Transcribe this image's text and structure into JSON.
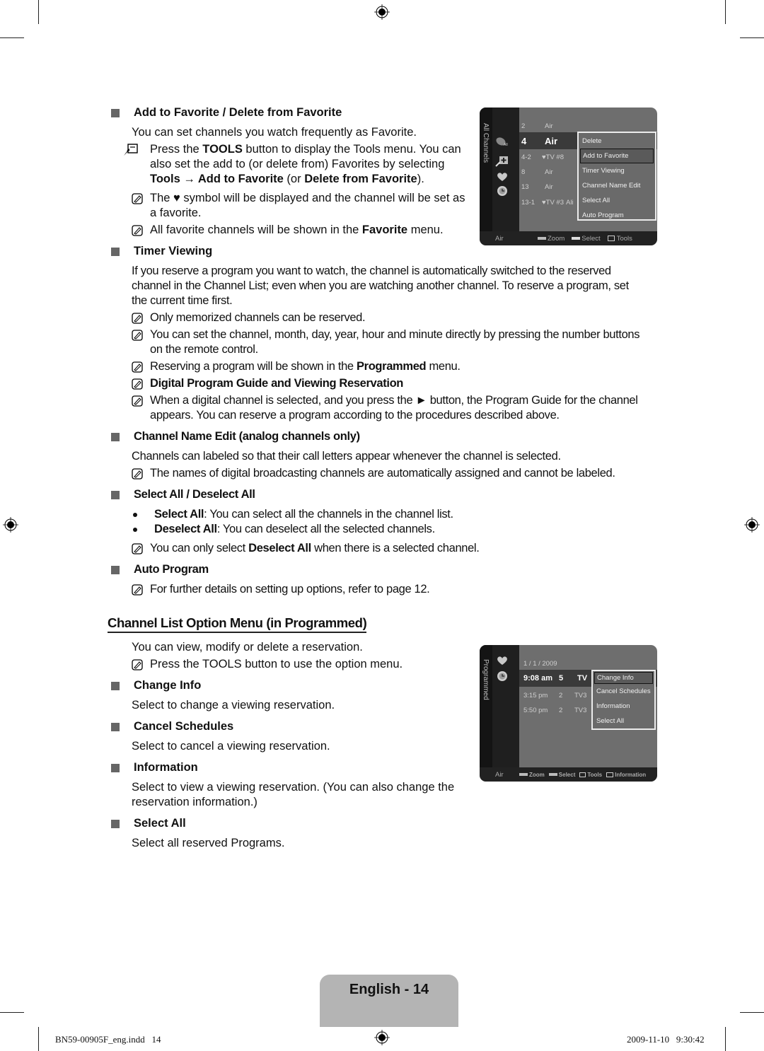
{
  "sections_top": {
    "add_fav": {
      "heading": "Add to Favorite / Delete from Favorite",
      "intro": "You can set channels you watch frequently as Favorite.",
      "tools_note": {
        "p1": "Press the ",
        "b1": "TOOLS",
        "p2": " button to display the Tools menu. You can also set the add to (or delete from) Favorites by selecting ",
        "b2": "Tools → Add to Favorite",
        "p3": " (or ",
        "b3": "Delete from Favorite",
        "p4": ")."
      },
      "note1": "The ♥ symbol will be displayed and the channel will be set as a favorite.",
      "note2": {
        "p1": "All favorite channels will be shown in the ",
        "b1": "Favorite",
        "p2": " menu."
      }
    },
    "timer": {
      "heading": "Timer Viewing",
      "body": "If you reserve a program you want to watch, the channel is automatically switched to the reserved channel in the Channel List; even when you are watching another channel. To reserve a program, set the current time first.",
      "note1": "Only memorized channels can be reserved.",
      "note2": "You can set the channel, month, day, year, hour and minute directly by pressing the number buttons on the remote control.",
      "note3": {
        "p1": "Reserving a program will be shown in the ",
        "b1": "Programmed",
        "p2": " menu."
      },
      "note4": "Digital Program Guide and Viewing Reservation",
      "note5": "When a digital channel is selected, and you press the ► button, the Program Guide for the channel appears. You can reserve a program according to the procedures described above."
    },
    "name_edit": {
      "heading": "Channel Name Edit (analog channels only)",
      "body": "Channels can labeled so that their call letters appear whenever the channel is selected.",
      "note1": "The names of digital broadcasting channels are automatically assigned and cannot be labeled."
    },
    "select_all": {
      "heading": "Select All / Deselect All",
      "bullet1": {
        "b": "Select All",
        "t": ": You can select all the channels in the channel list."
      },
      "bullet2": {
        "b": "Deselect All",
        "t": ": You can deselect all the selected channels."
      },
      "note1": {
        "p1": "You can only select ",
        "b1": "Deselect All",
        "p2": " when there is a selected channel."
      }
    },
    "auto_program": {
      "heading": "Auto Program",
      "note1": "For further details on setting up options, refer to page 12."
    }
  },
  "programmed": {
    "title": "Channel List Option Menu (in Programmed)",
    "intro": "You can view, modify or delete a reservation.",
    "note1": "Press the TOOLS button to use the option menu.",
    "items": [
      {
        "heading": "Change Info",
        "body": "Select to change a viewing reservation."
      },
      {
        "heading": "Cancel Schedules",
        "body": "Select to cancel a viewing reservation."
      },
      {
        "heading": "Information",
        "body": "Select to view a viewing reservation. (You can also change the reservation information.)"
      },
      {
        "heading": "Select All",
        "body": "Select all reserved Programs."
      }
    ]
  },
  "tv1": {
    "side_label": "All Channels",
    "rows": [
      {
        "num": "2",
        "name": "Air",
        "extra": ""
      },
      {
        "num": "4",
        "name": "Air",
        "extra": ""
      },
      {
        "num": "4-2",
        "name": "♥TV #8",
        "extra": ""
      },
      {
        "num": "8",
        "name": "Air",
        "extra": ""
      },
      {
        "num": "13",
        "name": "Air",
        "extra": ""
      },
      {
        "num": "13-1",
        "name": "♥TV #3",
        "extra": "Ali"
      }
    ],
    "menu": [
      "Delete",
      "Add to Favorite",
      "Timer Viewing",
      "Channel Name Edit",
      "Select All",
      "Auto Program"
    ],
    "menu_selected": 1,
    "bottom": {
      "source": "Air",
      "zoom": "Zoom",
      "select": "Select",
      "tools": "Tools"
    }
  },
  "tv2": {
    "side_label": "Programmed",
    "date": "1 / 1 / 2009",
    "rows": [
      {
        "time": "9:08 am",
        "ch": "5",
        "name": "TV"
      },
      {
        "time": "3:15 pm",
        "ch": "2",
        "name": "TV3"
      },
      {
        "time": "5:50 pm",
        "ch": "2",
        "name": "TV3"
      }
    ],
    "menu": [
      "Change Info",
      "Cancel Schedules",
      "Information",
      "Select All"
    ],
    "menu_selected": 0,
    "bottom": {
      "source": "Air",
      "zoom": "Zoom",
      "select": "Select",
      "tools": "Tools",
      "info": "Information"
    }
  },
  "footer": {
    "page_label": "English - 14",
    "file": "BN59-00905F_eng.indd   14",
    "timestamp": "2009-11-10   9:30:42"
  }
}
